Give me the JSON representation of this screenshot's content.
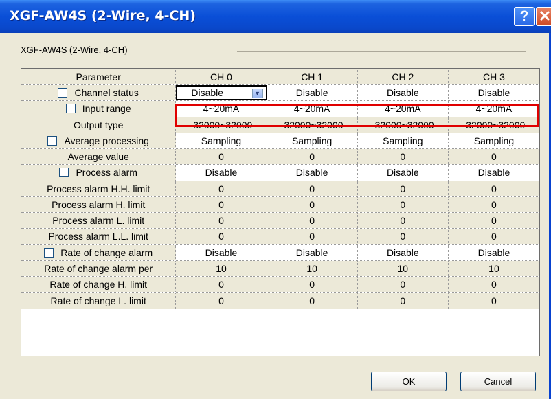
{
  "window": {
    "title": "XGF-AW4S (2-Wire, 4-CH)",
    "help_glyph": "?",
    "close_glyph": "✕"
  },
  "group": {
    "label": "XGF-AW4S (2-Wire, 4-CH)"
  },
  "table": {
    "headers": [
      "Parameter",
      "CH 0",
      "CH 1",
      "CH 2",
      "CH 3"
    ],
    "rows": [
      {
        "label": "Channel status",
        "checkbox": true,
        "values": [
          "Disable",
          "Disable",
          "Disable",
          "Disable"
        ]
      },
      {
        "label": "Input range",
        "checkbox": true,
        "values": [
          "4~20mA",
          "4~20mA",
          "4~20mA",
          "4~20mA"
        ]
      },
      {
        "label": "Output type",
        "checkbox": false,
        "values": [
          "-32000~32000",
          "-32000~32000",
          "-32000~32000",
          "-32000~32000"
        ]
      },
      {
        "label": "Average processing",
        "checkbox": true,
        "values": [
          "Sampling",
          "Sampling",
          "Sampling",
          "Sampling"
        ]
      },
      {
        "label": "Average value",
        "checkbox": false,
        "values": [
          "0",
          "0",
          "0",
          "0"
        ]
      },
      {
        "label": "Process alarm",
        "checkbox": true,
        "values": [
          "Disable",
          "Disable",
          "Disable",
          "Disable"
        ]
      },
      {
        "label": "Process alarm H.H. limit",
        "checkbox": false,
        "values": [
          "0",
          "0",
          "0",
          "0"
        ]
      },
      {
        "label": "Process alarm H. limit",
        "checkbox": false,
        "values": [
          "0",
          "0",
          "0",
          "0"
        ]
      },
      {
        "label": "Process alarm L. limit",
        "checkbox": false,
        "values": [
          "0",
          "0",
          "0",
          "0"
        ]
      },
      {
        "label": "Process alarm L.L. limit",
        "checkbox": false,
        "values": [
          "0",
          "0",
          "0",
          "0"
        ]
      },
      {
        "label": "Rate of change alarm",
        "checkbox": true,
        "values": [
          "Disable",
          "Disable",
          "Disable",
          "Disable"
        ]
      },
      {
        "label": "Rate of change alarm per",
        "checkbox": false,
        "values": [
          "10",
          "10",
          "10",
          "10"
        ]
      },
      {
        "label": "Rate of change H. limit",
        "checkbox": false,
        "values": [
          "0",
          "0",
          "0",
          "0"
        ]
      },
      {
        "label": "Rate of change L. limit",
        "checkbox": false,
        "values": [
          "0",
          "0",
          "0",
          "0"
        ]
      }
    ]
  },
  "buttons": {
    "ok": "OK",
    "cancel": "Cancel"
  },
  "colors": {
    "titlebar": "#0a4fd7",
    "dialog_bg": "#ece9d8",
    "highlight": "#e00000"
  }
}
